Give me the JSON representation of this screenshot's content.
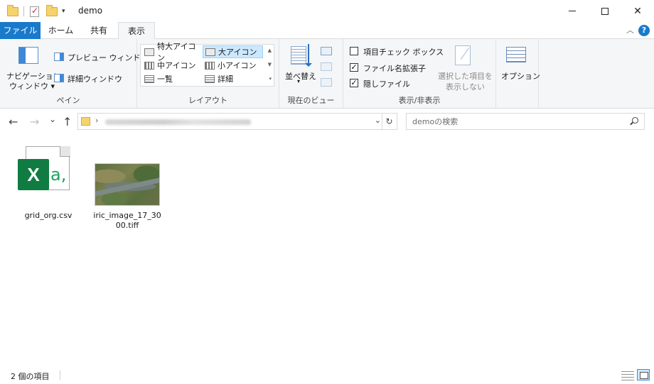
{
  "window": {
    "title": "demo",
    "minimize_glyph": "",
    "maximize_glyph": "",
    "close_glyph": "✕"
  },
  "quick_access": {
    "dropdown_glyph": "▾"
  },
  "tabs": [
    {
      "label": "ファイル"
    },
    {
      "label": "ホーム"
    },
    {
      "label": "共有"
    },
    {
      "label": "表示"
    }
  ],
  "help_glyph": "?",
  "ribbon_collapse_glyph": "︿",
  "ribbon": {
    "pane_group": {
      "nav_pane_line1": "ナビゲーション",
      "nav_pane_line2": "ウィンドウ ▾",
      "preview_pane": "プレビュー ウィンドウ",
      "details_pane": "詳細ウィンドウ",
      "label": "ペイン"
    },
    "layout_group": {
      "items": [
        {
          "label": "特大アイコン"
        },
        {
          "label": "大アイコン"
        },
        {
          "label": "中アイコン"
        },
        {
          "label": "小アイコン"
        },
        {
          "label": "一覧"
        },
        {
          "label": "詳細"
        }
      ],
      "selected": "大アイコン",
      "label": "レイアウト"
    },
    "current_view_group": {
      "sort_by_line1": "並べ替え",
      "sort_by_line2": "▾",
      "label": "現在のビュー"
    },
    "show_hide_group": {
      "checkboxes": [
        {
          "label": "項目チェック ボックス",
          "checked": false
        },
        {
          "label": "ファイル名拡張子",
          "checked": true
        },
        {
          "label": "隠しファイル",
          "checked": true
        }
      ],
      "hide_selected_line1": "選択した項目を",
      "hide_selected_line2": "表示しない",
      "label": "表示/非表示"
    },
    "options_group": {
      "options": "オプション"
    }
  },
  "navigation": {
    "back_glyph": "←",
    "forward_glyph": "→",
    "recent_glyph": "⌄",
    "up_glyph": "↑",
    "address_chevron": "›",
    "address_dropdown": "⌄",
    "refresh_glyph": "↻",
    "search_placeholder": "demoの検索"
  },
  "files": [
    {
      "name": "grid_org.csv",
      "icon": "excel-csv-icon",
      "xl_letter": "X",
      "a_letter": "a,"
    },
    {
      "name_line1": "iric_image_17_30",
      "name_line2": "00.tiff",
      "icon": "tiff-thumbnail"
    }
  ],
  "status": {
    "item_count": "2 個の項目"
  },
  "colors": {
    "accent": "#1979ca",
    "excel_green": "#107c41",
    "selected_bg": "#cce8ff"
  }
}
